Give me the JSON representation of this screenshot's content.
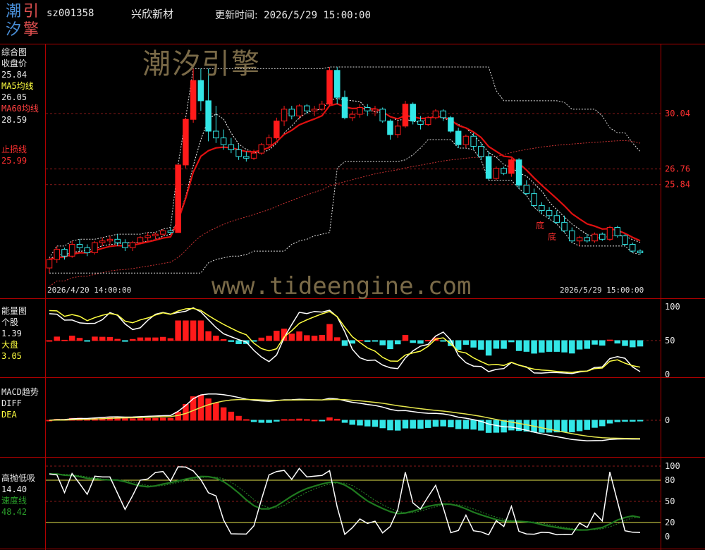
{
  "header": {
    "logo_chars": [
      "潮",
      "引",
      "汐",
      "擎"
    ],
    "stock_code": "sz001358",
    "stock_name": "兴欣新材",
    "update_label": "更新时间:",
    "update_time": "2026/5/29 15:00:00"
  },
  "panels": {
    "main": {
      "title": "综合图",
      "close_label": "收盘价",
      "close_value": "25.84",
      "ma5_label": "MA5均线",
      "ma5_value": "26.05",
      "ma60_label": "MA60均线",
      "ma60_value": "28.59",
      "stop_label": "止损线",
      "stop_value": "25.99",
      "price_axis": [
        "30.04",
        "26.76",
        "25.84"
      ],
      "marker_labels": [
        "底",
        "底"
      ],
      "date_start": "2026/4/20 14:00:00",
      "date_end": "2026/5/29 15:00:00"
    },
    "energy": {
      "title": "能量图",
      "stock_label": "个股",
      "stock_value": "1.39",
      "market_label": "大盘",
      "market_value": "3.05",
      "axis": [
        "100",
        "50",
        "0"
      ]
    },
    "macd": {
      "title": "MACD趋势",
      "diff_label": "DIFF",
      "dea_label": "DEA",
      "axis": [
        "0"
      ]
    },
    "osc": {
      "title": "高抛低吸",
      "value": "14.40",
      "speed_label": "速度线",
      "speed_value": "48.42",
      "axis": [
        "100",
        "80",
        "50",
        "20",
        "0"
      ]
    }
  },
  "watermarks": {
    "cn": "潮汐引擎",
    "url": "www.tideengine.com"
  },
  "colors": {
    "up": "#ff1a1a",
    "down": "#33e6e6",
    "ma5": "#ffffff",
    "ma60": "#cc3333",
    "stop": "#e01010",
    "diff": "#ffffff",
    "dea": "#e6e64d",
    "speed": "#1f7a1f",
    "border": "#b00000"
  },
  "chart_data": {
    "type": "candlestick",
    "candles": [
      [
        20.9,
        21.5,
        20.6,
        21.4
      ],
      [
        21.4,
        22.2,
        21.2,
        22.0
      ],
      [
        22.0,
        22.1,
        21.4,
        21.6
      ],
      [
        21.6,
        22.5,
        21.5,
        22.3
      ],
      [
        22.3,
        22.6,
        21.9,
        22.1
      ],
      [
        22.1,
        22.3,
        21.6,
        21.8
      ],
      [
        21.8,
        22.5,
        21.7,
        22.4
      ],
      [
        22.4,
        22.7,
        22.2,
        22.5
      ],
      [
        22.5,
        22.8,
        22.3,
        22.6
      ],
      [
        22.6,
        22.9,
        22.2,
        22.4
      ],
      [
        22.4,
        22.6,
        21.9,
        22.1
      ],
      [
        22.1,
        22.5,
        21.9,
        22.4
      ],
      [
        22.4,
        22.8,
        22.3,
        22.7
      ],
      [
        22.7,
        23.0,
        22.5,
        22.8
      ],
      [
        22.8,
        23.0,
        22.6,
        22.9
      ],
      [
        22.9,
        23.2,
        22.8,
        23.1
      ],
      [
        23.1,
        23.3,
        22.9,
        23.0
      ],
      [
        23.0,
        27.0,
        23.0,
        27.0
      ],
      [
        27.0,
        29.8,
        26.8,
        29.7
      ],
      [
        29.7,
        32.7,
        29.5,
        32.0
      ],
      [
        32.0,
        32.7,
        30.2,
        30.8
      ],
      [
        30.8,
        32.7,
        28.4,
        29.0
      ],
      [
        29.0,
        30.5,
        28.3,
        28.6
      ],
      [
        28.6,
        29.1,
        27.9,
        28.2
      ],
      [
        28.2,
        28.6,
        27.7,
        27.9
      ],
      [
        27.9,
        28.2,
        27.3,
        27.5
      ],
      [
        27.5,
        27.8,
        27.2,
        27.4
      ],
      [
        27.4,
        27.9,
        27.3,
        27.7
      ],
      [
        27.7,
        28.3,
        27.6,
        28.2
      ],
      [
        28.2,
        28.8,
        28.0,
        28.6
      ],
      [
        28.6,
        29.8,
        28.5,
        29.6
      ],
      [
        29.6,
        30.5,
        29.3,
        30.3
      ],
      [
        30.3,
        30.5,
        29.7,
        29.9
      ],
      [
        29.9,
        30.6,
        29.7,
        30.5
      ],
      [
        30.5,
        30.6,
        30.0,
        30.2
      ],
      [
        30.2,
        30.5,
        29.9,
        30.3
      ],
      [
        30.3,
        30.8,
        30.2,
        30.6
      ],
      [
        30.6,
        32.8,
        30.5,
        32.6
      ],
      [
        32.6,
        32.8,
        30.6,
        31.0
      ],
      [
        31.0,
        31.4,
        29.7,
        29.8
      ],
      [
        29.8,
        30.2,
        29.6,
        30.0
      ],
      [
        30.0,
        30.6,
        29.8,
        30.4
      ],
      [
        30.4,
        30.6,
        29.9,
        30.2
      ],
      [
        30.2,
        30.5,
        29.9,
        30.3
      ],
      [
        30.3,
        30.4,
        29.5,
        29.6
      ],
      [
        29.6,
        29.7,
        28.5,
        28.8
      ],
      [
        28.8,
        29.6,
        28.6,
        29.3
      ],
      [
        29.3,
        30.8,
        29.2,
        30.6
      ],
      [
        30.6,
        30.7,
        29.4,
        29.6
      ],
      [
        29.6,
        29.9,
        29.1,
        29.4
      ],
      [
        29.4,
        29.9,
        29.3,
        29.8
      ],
      [
        29.8,
        30.3,
        29.7,
        30.2
      ],
      [
        30.2,
        30.3,
        29.6,
        29.8
      ],
      [
        29.8,
        29.9,
        28.9,
        29.0
      ],
      [
        29.0,
        29.2,
        28.0,
        28.2
      ],
      [
        28.2,
        28.8,
        28.0,
        28.7
      ],
      [
        28.7,
        28.9,
        27.9,
        28.1
      ],
      [
        28.1,
        28.3,
        27.3,
        27.5
      ],
      [
        27.5,
        27.8,
        26.1,
        26.2
      ],
      [
        26.2,
        26.9,
        26.1,
        26.8
      ],
      [
        26.8,
        26.9,
        26.4,
        26.5
      ],
      [
        26.5,
        27.4,
        26.3,
        27.3
      ],
      [
        27.3,
        27.4,
        25.6,
        25.8
      ],
      [
        25.8,
        26.1,
        25.2,
        25.3
      ],
      [
        25.3,
        25.6,
        24.5,
        24.6
      ],
      [
        24.6,
        24.8,
        24.1,
        24.3
      ],
      [
        24.3,
        24.5,
        23.8,
        24.0
      ],
      [
        24.0,
        24.3,
        23.5,
        23.6
      ],
      [
        23.6,
        24.0,
        23.0,
        23.1
      ],
      [
        23.1,
        23.3,
        22.4,
        22.5
      ],
      [
        22.5,
        22.8,
        22.2,
        22.7
      ],
      [
        22.7,
        22.9,
        22.4,
        22.5
      ],
      [
        22.5,
        23.0,
        22.4,
        22.9
      ],
      [
        22.9,
        23.0,
        22.5,
        22.6
      ],
      [
        22.6,
        23.4,
        22.5,
        23.3
      ],
      [
        23.3,
        23.4,
        22.7,
        22.8
      ],
      [
        22.8,
        22.9,
        22.2,
        22.3
      ],
      [
        22.3,
        22.4,
        21.8,
        21.9
      ],
      [
        21.9,
        22.0,
        21.7,
        21.8
      ]
    ],
    "x_labels": [
      "2026/4/20 14:00:00",
      "2026/5/29 15:00:00"
    ],
    "reference_lines": [
      30.04,
      26.76,
      25.84
    ]
  }
}
